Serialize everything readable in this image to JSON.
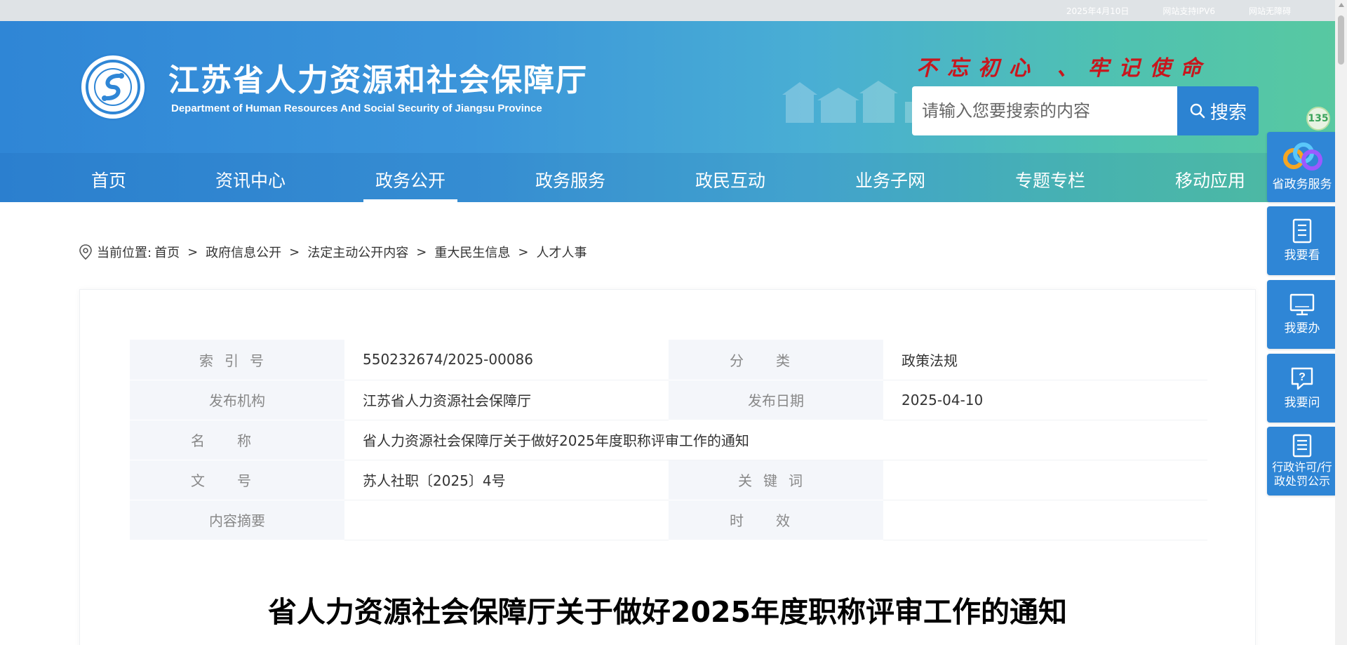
{
  "topbar": {
    "date": "2025年4月10日",
    "ipv6": "网站支持IPV6",
    "accessible": "网站无障碍"
  },
  "header": {
    "title": "江苏省人力资源和社会保障厅",
    "subtitle": "Department of Human Resources And Social Security of Jiangsu Province",
    "slogan": "不忘初心 、牢记使命",
    "logo_icon": "hrss-emblem-icon",
    "brand_color": "#2f86d6",
    "slogan_color": "#c8161d"
  },
  "search": {
    "placeholder": "请输入您要搜索的内容",
    "button_label": "搜索"
  },
  "nav": {
    "items": [
      {
        "label": "首页"
      },
      {
        "label": "资讯中心"
      },
      {
        "label": "政务公开"
      },
      {
        "label": "政务服务"
      },
      {
        "label": "政民互动"
      },
      {
        "label": "业务子网"
      },
      {
        "label": "专题专栏"
      },
      {
        "label": "移动应用"
      }
    ],
    "active": "政务公开"
  },
  "breadcrumb": {
    "prefix": "当前位置:",
    "items": [
      "首页",
      "政府信息公开",
      "法定主动公开内容",
      "重大民生信息",
      "人才人事"
    ],
    "separator": ">"
  },
  "info": {
    "index_label": "索引号",
    "index_value": "550232674/2025-00086",
    "category_label": "分类",
    "category_value": "政策法规",
    "publisher_label": "发布机构",
    "publisher_value": "江苏省人力资源社会保障厅",
    "date_label": "发布日期",
    "date_value": "2025-04-10",
    "name_label": "名称",
    "name_value": "省人力资源社会保障厅关于做好2025年度职称评审工作的通知",
    "docno_label": "文号",
    "docno_value": "苏人社职〔2025〕4号",
    "keywords_label": "关键词",
    "keywords_value": "",
    "summary_label": "内容摘要",
    "summary_value": "",
    "validity_label": "时效",
    "validity_value": ""
  },
  "document": {
    "title": "省人力资源社会保障厅关于做好2025年度职称评审工作的通知"
  },
  "float_bar": {
    "badge": "135",
    "items": [
      {
        "label": "省政务服务",
        "icon": "gov-service-logo-icon"
      },
      {
        "label": "我要看",
        "icon": "notebook-icon"
      },
      {
        "label": "我要办",
        "icon": "monitor-icon"
      },
      {
        "label": "我要问",
        "icon": "question-bubble-icon"
      },
      {
        "label": "行政许可/行政处罚公示",
        "icon": "document-list-icon"
      }
    ]
  }
}
